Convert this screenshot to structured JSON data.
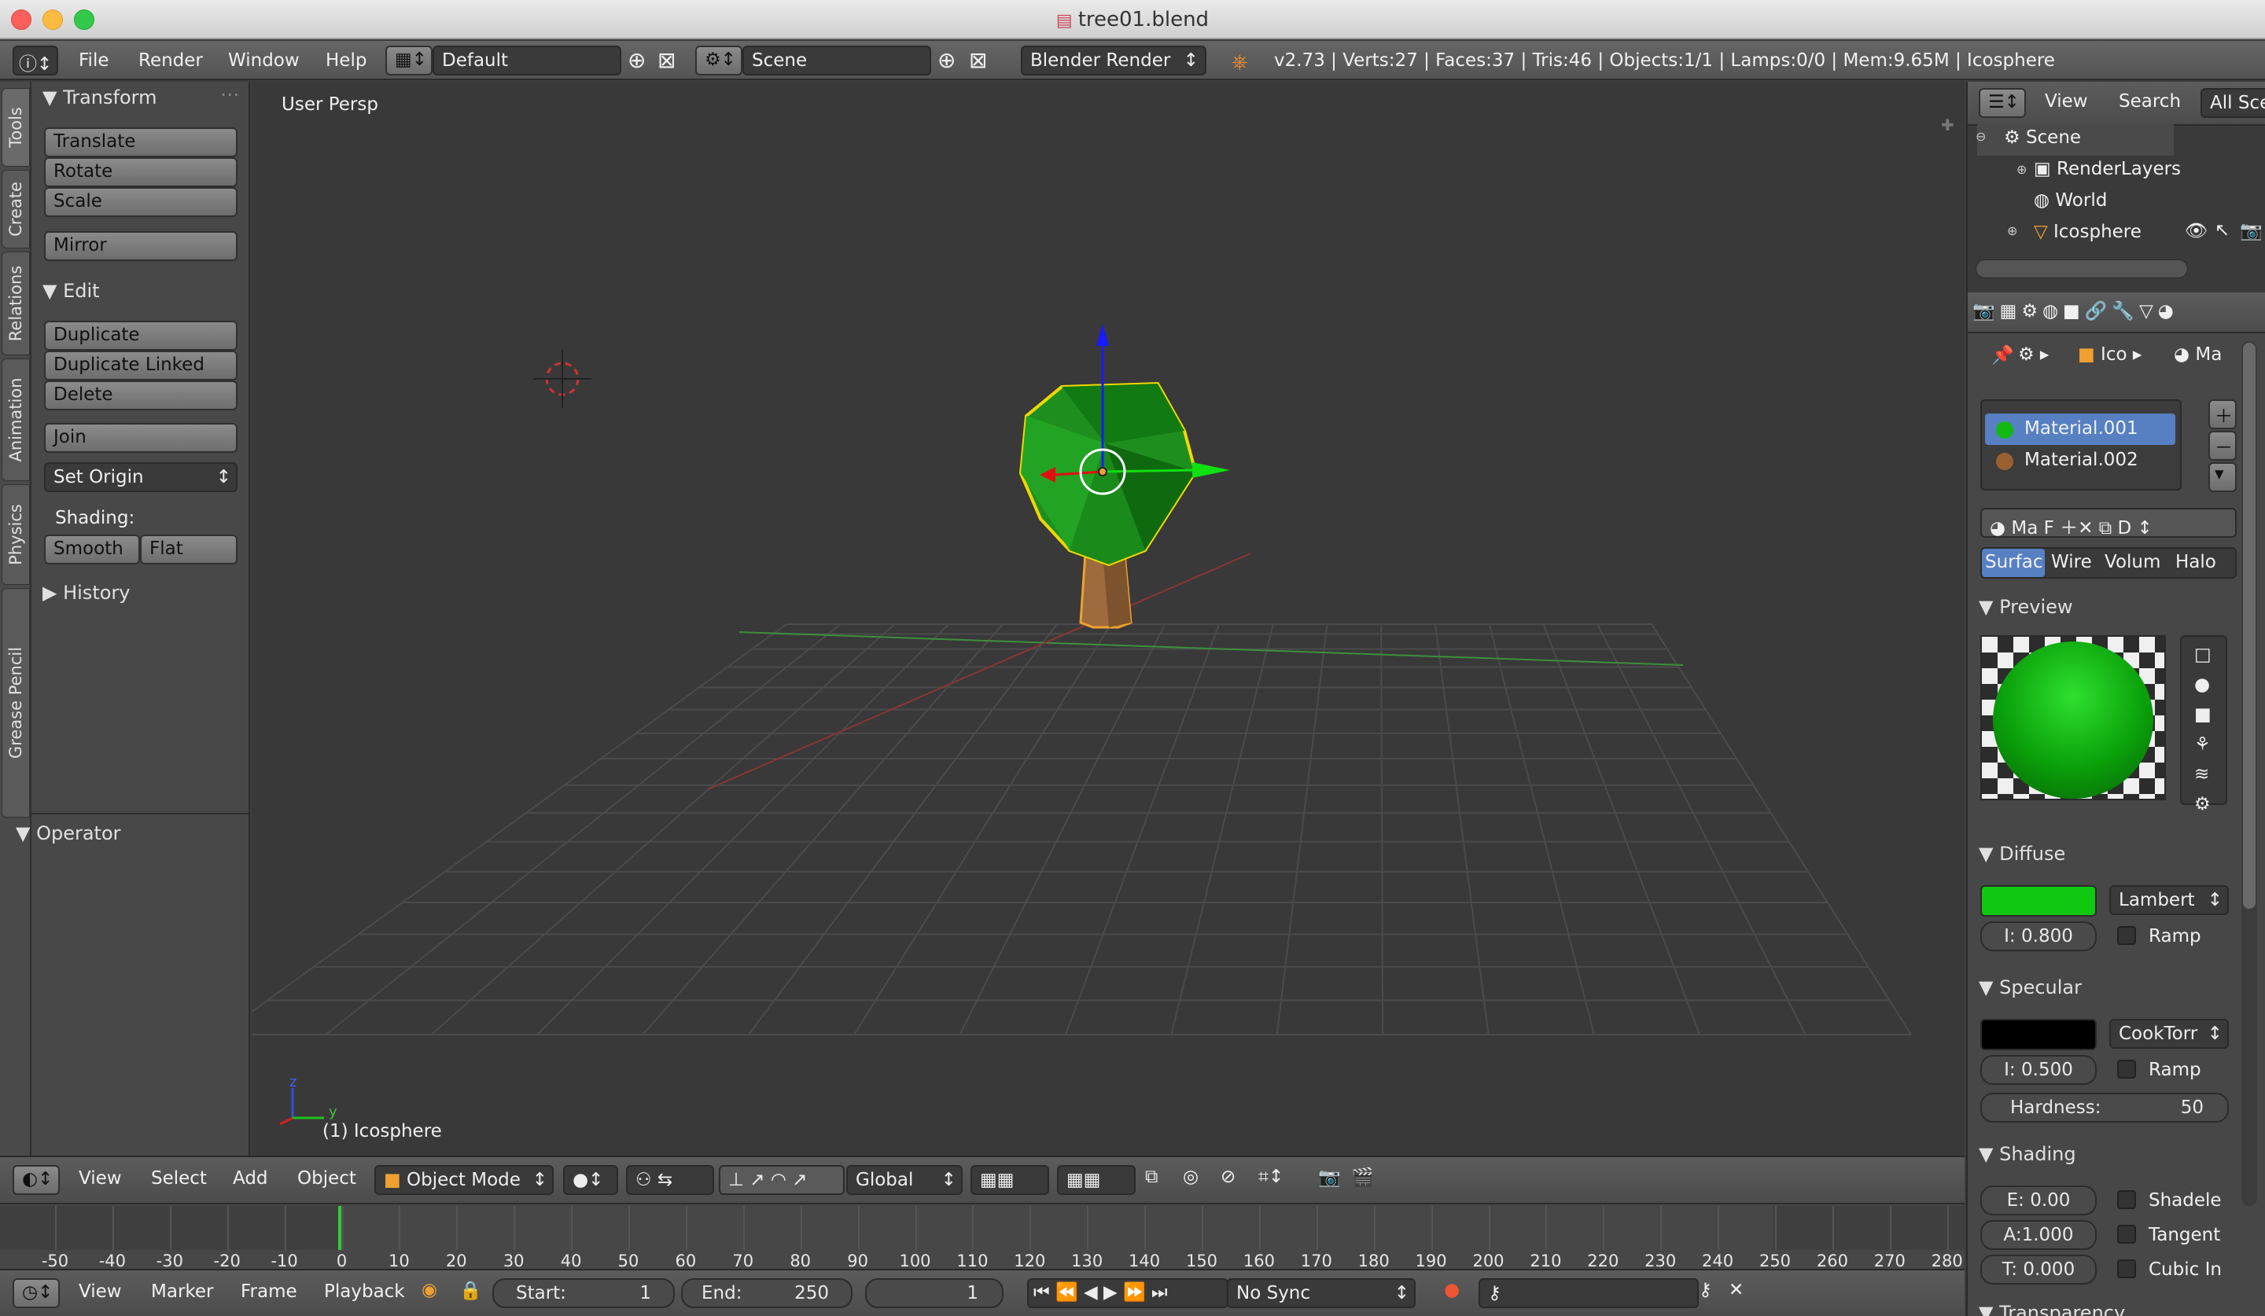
{
  "window": {
    "title": "tree01.blend"
  },
  "infobar": {
    "menus": [
      "File",
      "Render",
      "Window",
      "Help"
    ],
    "layout": "Default",
    "scene": "Scene",
    "engine": "Blender Render",
    "stats": "v2.73 | Verts:27 | Faces:37 | Tris:46 | Objects:1/1 | Lamps:0/0 | Mem:9.65M | Icosphere"
  },
  "tabs": [
    "Tools",
    "Create",
    "Relations",
    "Animation",
    "Physics",
    "Grease Pencil"
  ],
  "tools": {
    "transform": "Transform",
    "translate": "Translate",
    "rotate": "Rotate",
    "scale": "Scale",
    "mirror": "Mirror",
    "edit": "Edit",
    "duplicate": "Duplicate",
    "duplicate_linked": "Duplicate Linked",
    "delete": "Delete",
    "join": "Join",
    "set_origin": "Set Origin",
    "shading": "Shading:",
    "smooth": "Smooth",
    "flat": "Flat",
    "history": "History",
    "operator": "Operator"
  },
  "viewport": {
    "label": "User Persp",
    "object": "(1) Icosphere",
    "axis_z": "z",
    "axis_y": "y"
  },
  "vp_header": {
    "view": "View",
    "select": "Select",
    "add": "Add",
    "object": "Object",
    "mode": "Object Mode",
    "orientation": "Global"
  },
  "timeline": {
    "ticks": [
      "-50",
      "-40",
      "-30",
      "-20",
      "-10",
      "0",
      "10",
      "20",
      "30",
      "40",
      "50",
      "60",
      "70",
      "80",
      "90",
      "100",
      "110",
      "120",
      "130",
      "140",
      "150",
      "160",
      "170",
      "180",
      "190",
      "200",
      "210",
      "220",
      "230",
      "240",
      "250",
      "260",
      "270",
      "280"
    ]
  },
  "tl_header": {
    "view": "View",
    "marker": "Marker",
    "frame": "Frame",
    "playback": "Playback",
    "start_label": "Start:",
    "start": "1",
    "end_label": "End:",
    "end": "250",
    "current": "1",
    "sync": "No Sync"
  },
  "outliner": {
    "view": "View",
    "search": "Search",
    "all": "All Sce",
    "items": [
      "Scene",
      "RenderLayers",
      "World",
      "Icosphere"
    ]
  },
  "props": {
    "crumb1": "Ico",
    "crumb2": "Ma",
    "materials": [
      "Material.001",
      "Material.002"
    ],
    "mat_short": "Ma",
    "f": "F",
    "d": "D",
    "types": [
      "Surfac",
      "Wire",
      "Volum",
      "Halo"
    ],
    "preview": "Preview",
    "diffuse": "Diffuse",
    "diffuse_color": "#10c810",
    "lambert": "Lambert",
    "di": "I:",
    "di_val": "0.800",
    "ramp": "Ramp",
    "specular": "Specular",
    "cooktorr": "CookTorr",
    "si": "I:",
    "si_val": "0.500",
    "hardness": "Hardness:",
    "hardness_val": "50",
    "shading": "Shading",
    "e": "E:",
    "e_val": "0.00",
    "a": "A:",
    "a_val": "1.000",
    "t": "T:",
    "t_val": "0.000",
    "shadeless": "Shadele",
    "tangent": "Tangent",
    "cubic": "Cubic In",
    "transparency": "Transparency"
  }
}
